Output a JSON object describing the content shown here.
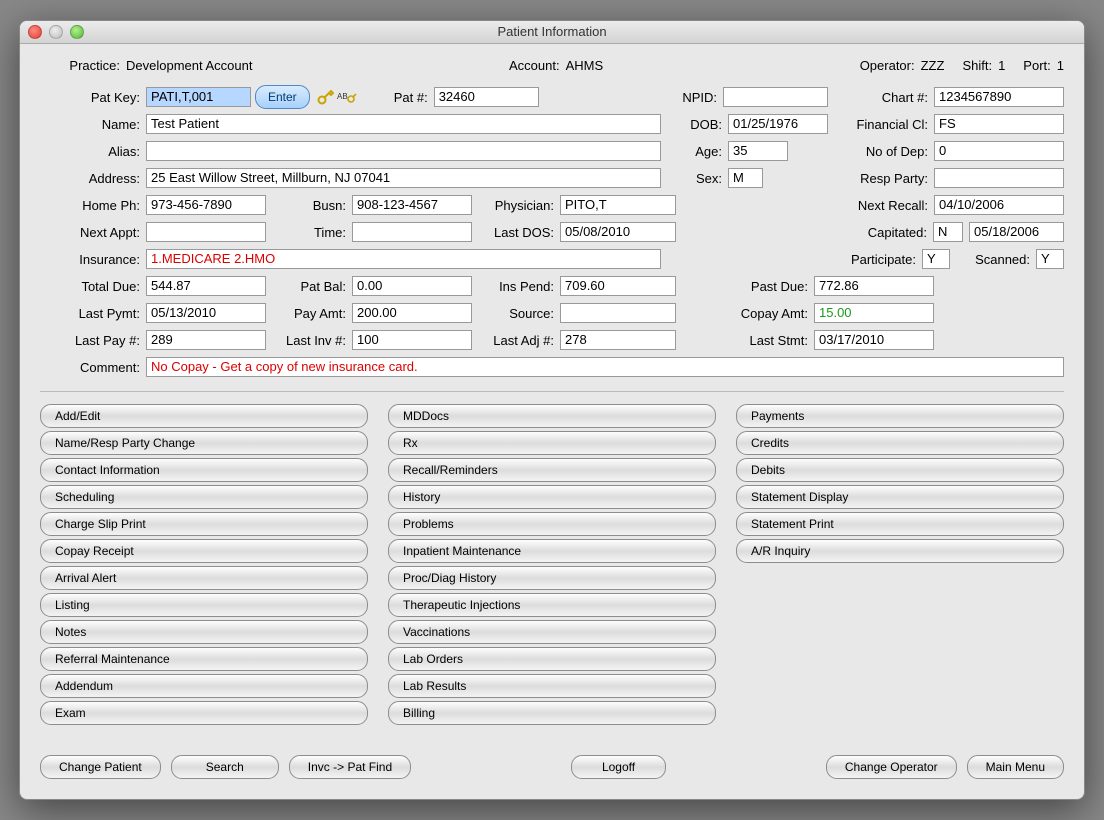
{
  "window_title": "Patient Information",
  "header": {
    "practice_label": "Practice:",
    "practice_value": "Development Account",
    "account_label": "Account:",
    "account_value": "AHMS",
    "operator_label": "Operator:",
    "operator_value": "ZZZ",
    "shift_label": "Shift:",
    "shift_value": "1",
    "port_label": "Port:",
    "port_value": "1"
  },
  "labels": {
    "pat_key": "Pat Key:",
    "enter": "Enter",
    "pat_num": "Pat #:",
    "npid": "NPID:",
    "chart_num": "Chart #:",
    "name": "Name:",
    "dob": "DOB:",
    "financial_cl": "Financial Cl:",
    "alias": "Alias:",
    "age": "Age:",
    "no_of_dep": "No of Dep:",
    "address": "Address:",
    "sex": "Sex:",
    "resp_party": "Resp Party:",
    "home_ph": "Home Ph:",
    "busn": "Busn:",
    "physician": "Physician:",
    "next_recall": "Next Recall:",
    "next_appt": "Next Appt:",
    "time": "Time:",
    "last_dos": "Last DOS:",
    "capitated": "Capitated:",
    "insurance": "Insurance:",
    "participate": "Participate:",
    "scanned": "Scanned:",
    "total_due": "Total Due:",
    "pat_bal": "Pat Bal:",
    "ins_pend": "Ins Pend:",
    "past_due": "Past Due:",
    "last_pymt": "Last Pymt:",
    "pay_amt": "Pay Amt:",
    "source": "Source:",
    "copay_amt": "Copay Amt:",
    "last_pay_num": "Last Pay #:",
    "last_inv_num": "Last Inv #:",
    "last_adj_num": "Last Adj #:",
    "last_stmt": "Last Stmt:",
    "comment": "Comment:"
  },
  "values": {
    "pat_key": "PATI,T,001",
    "pat_num": "32460",
    "npid": "",
    "chart_num": "1234567890",
    "name": "Test Patient",
    "dob": "01/25/1976",
    "financial_cl": "FS",
    "alias": "",
    "age": "35",
    "no_of_dep": "0",
    "address": "25 East Willow Street, Millburn, NJ 07041",
    "sex": "M",
    "resp_party": "",
    "home_ph": "973-456-7890",
    "busn": "908-123-4567",
    "physician": "PITO,T",
    "next_recall": "04/10/2006",
    "next_appt": "",
    "time": "",
    "last_dos": "05/08/2010",
    "capitated_flag": "N",
    "capitated_date": "05/18/2006",
    "insurance": "1.MEDICARE 2.HMO",
    "participate": "Y",
    "scanned": "Y",
    "total_due": "544.87",
    "pat_bal": "0.00",
    "ins_pend": "709.60",
    "past_due": "772.86",
    "last_pymt": "05/13/2010",
    "pay_amt": "200.00",
    "source": "",
    "copay_amt": "15.00",
    "last_pay_num": "289",
    "last_inv_num": "100",
    "last_adj_num": "278",
    "last_stmt": "03/17/2010",
    "comment": "No Copay - Get a copy of new insurance card."
  },
  "menu": {
    "col1": [
      "Add/Edit",
      "Name/Resp Party Change",
      "Contact Information",
      "Scheduling",
      "Charge Slip Print",
      "Copay Receipt",
      "Arrival Alert",
      "Listing",
      "Notes",
      "Referral Maintenance",
      "Addendum",
      "Exam"
    ],
    "col2": [
      "MDDocs",
      "Rx",
      "Recall/Reminders",
      "History",
      "Problems",
      "Inpatient Maintenance",
      "Proc/Diag History",
      "Therapeutic Injections",
      "Vaccinations",
      "Lab Orders",
      "Lab Results",
      "Billing"
    ],
    "col3": [
      "Payments",
      "Credits",
      "Debits",
      "Statement Display",
      "Statement Print",
      "A/R Inquiry"
    ]
  },
  "bottom": {
    "change_patient": "Change Patient",
    "search": "Search",
    "invc_pat_find": "Invc -> Pat Find",
    "logoff": "Logoff",
    "change_operator": "Change Operator",
    "main_menu": "Main Menu"
  }
}
